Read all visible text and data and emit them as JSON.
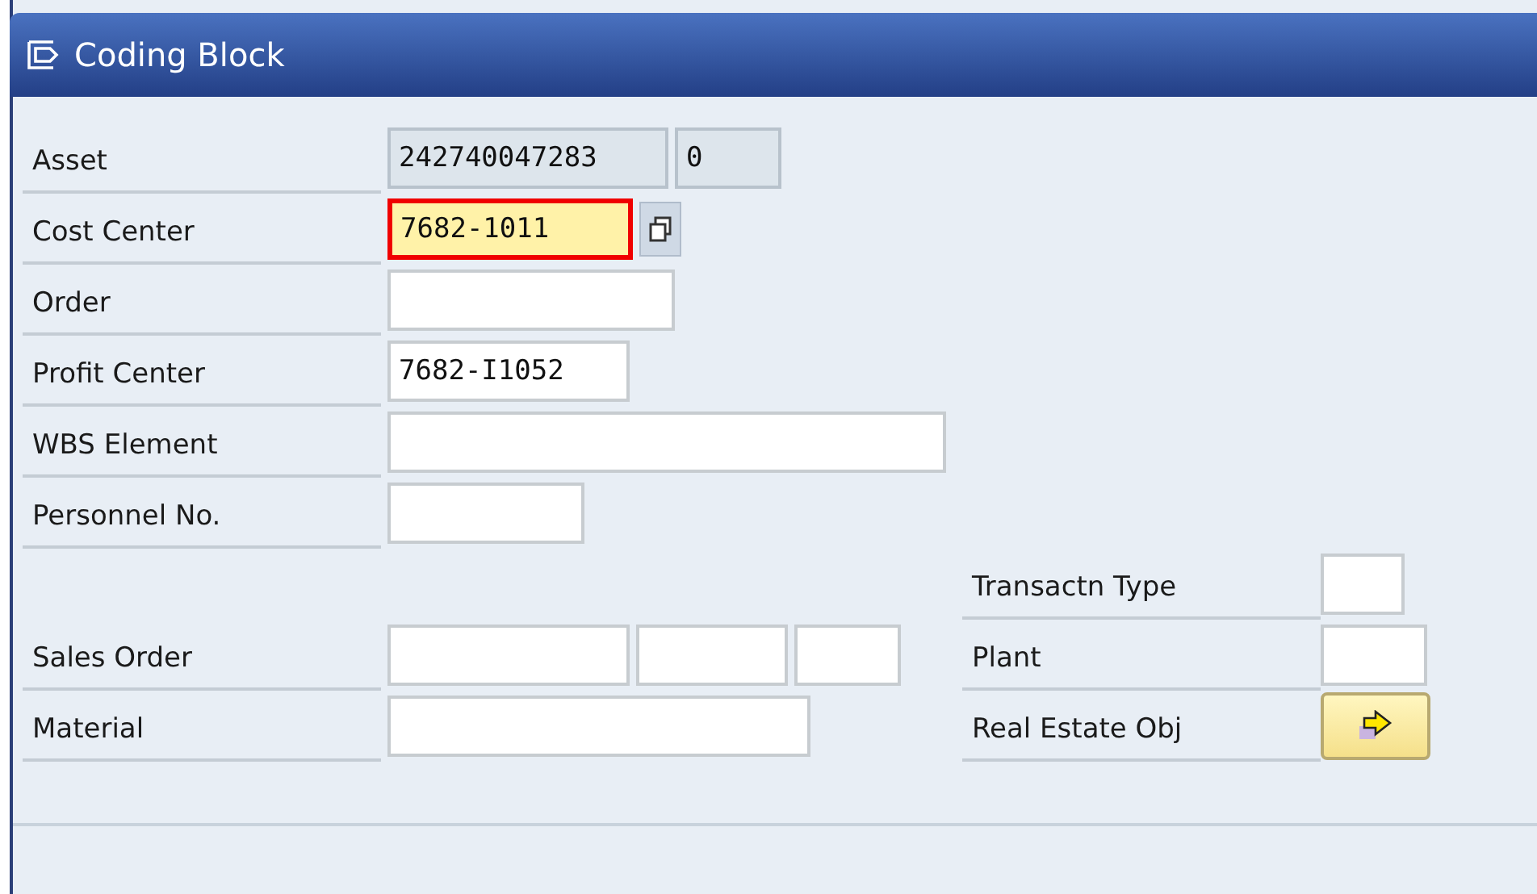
{
  "window": {
    "title": "Coding Block"
  },
  "left_rows": [
    {
      "label": "Asset",
      "fields": [
        {
          "kind": "readonly",
          "value": "242740047283"
        },
        {
          "kind": "readonly",
          "value": "0"
        }
      ]
    },
    {
      "label": "Cost Center",
      "fields": [
        {
          "kind": "input",
          "value": "7682-1011",
          "highlighted": true
        },
        {
          "kind": "button"
        }
      ]
    },
    {
      "label": "Order",
      "fields": [
        {
          "kind": "input"
        }
      ]
    },
    {
      "label": "Profit Center",
      "fields": [
        {
          "kind": "input",
          "value": "7682-I1052"
        }
      ]
    },
    {
      "label": "WBS Element",
      "fields": [
        {
          "kind": "input"
        }
      ]
    },
    {
      "label": "Personnel No.",
      "fields": [
        {
          "kind": "input"
        }
      ]
    },
    {
      "label": "Sales Order",
      "fields": [
        {
          "kind": "input"
        },
        {
          "kind": "input"
        },
        {
          "kind": "input"
        }
      ]
    },
    {
      "label": "Material",
      "fields": [
        {
          "kind": "input"
        }
      ]
    }
  ],
  "right_rows": [
    {
      "label": "Transactn Type",
      "fields": [
        {
          "kind": "input"
        }
      ]
    },
    {
      "label": "Plant",
      "fields": [
        {
          "kind": "input"
        }
      ]
    },
    {
      "label": "Real Estate Obj",
      "fields": [
        {
          "kind": "button"
        }
      ]
    }
  ]
}
